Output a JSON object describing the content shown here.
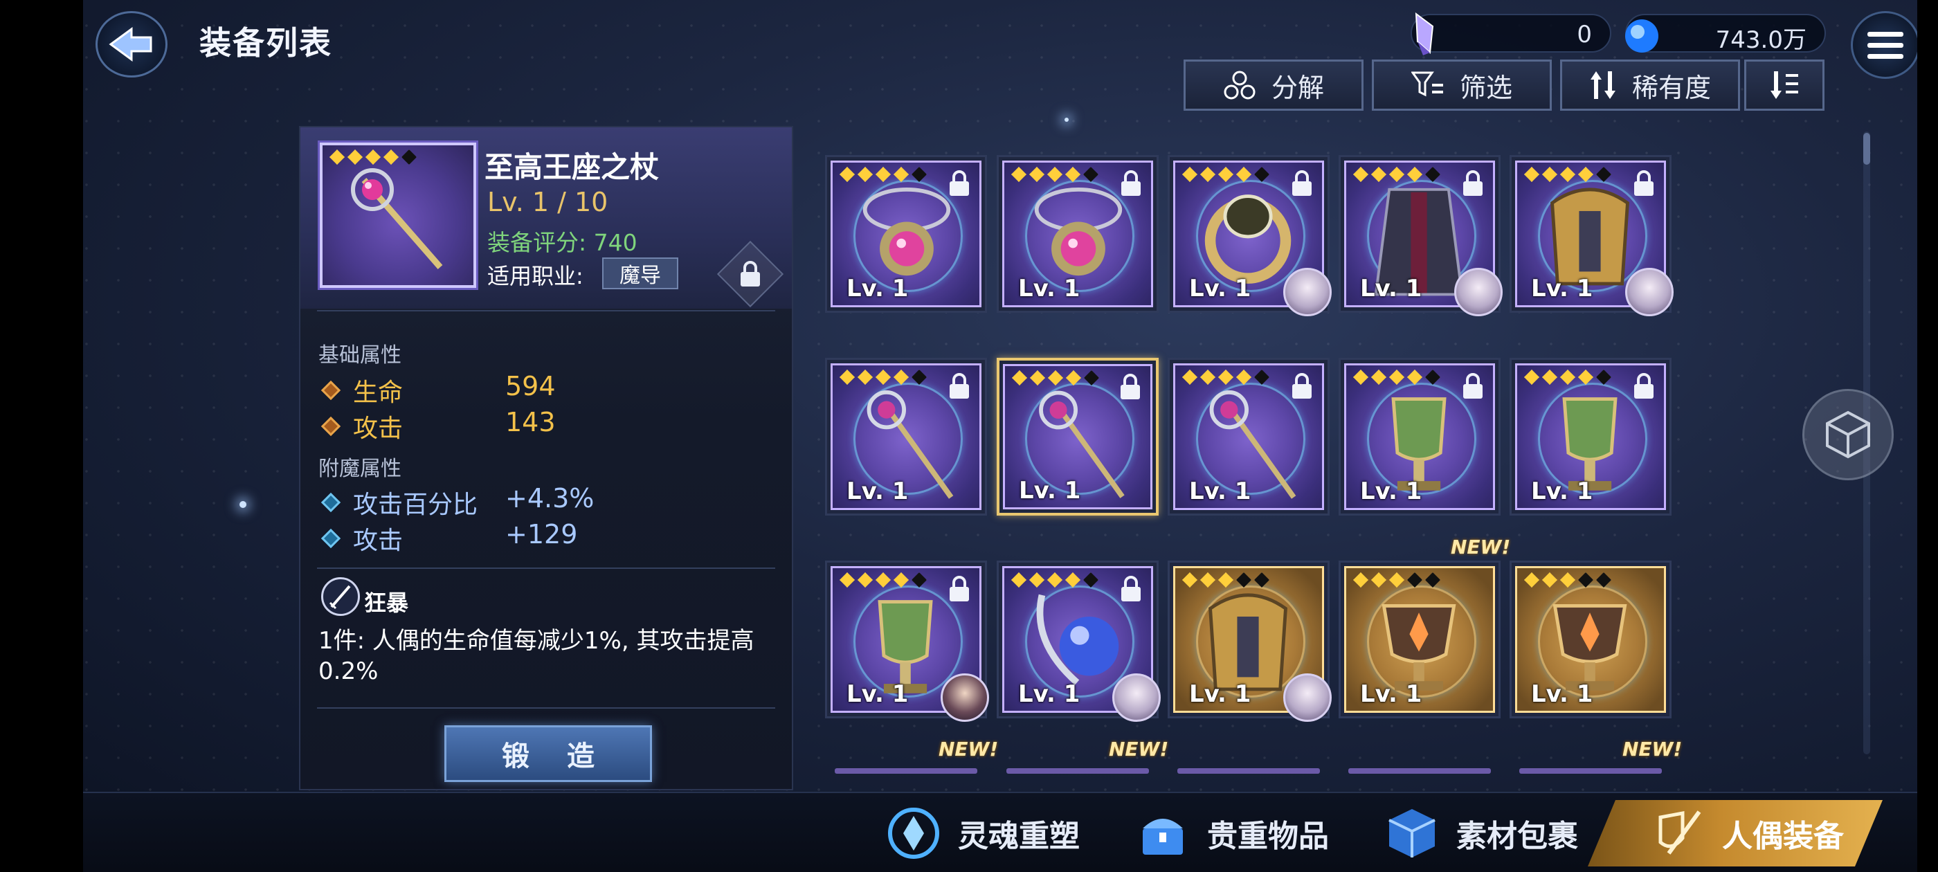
{
  "header": {
    "title": "装备列表",
    "currency_crystal": "0",
    "currency_orb": "743.0万"
  },
  "toolbar": {
    "decompose": "分解",
    "filter": "筛选",
    "rarity": "稀有度"
  },
  "detail": {
    "name": "至高王座之杖",
    "level": "Lv. 1 / 10",
    "score": "装备评分: 740",
    "class_label": "适用职业:",
    "class_value": "魔导",
    "base_header": "基础属性",
    "base": [
      {
        "label": "生命",
        "value": "594"
      },
      {
        "label": "攻击",
        "value": "143"
      }
    ],
    "enchant_header": "附魔属性",
    "enchant": [
      {
        "label": "攻击百分比",
        "value": "+4.3%"
      },
      {
        "label": "攻击",
        "value": "+129"
      }
    ],
    "set_name": "狂暴",
    "set_desc": "1件: 人偶的生命值每减少1%, 其攻击提高0.2%",
    "forge": "锻 造"
  },
  "items": [
    {
      "lv": "Lv. 1",
      "locked": true,
      "avatar": false,
      "selected": false,
      "gold": false,
      "stars": 4,
      "icon": "amulet-icon"
    },
    {
      "lv": "Lv. 1",
      "locked": true,
      "avatar": false,
      "selected": false,
      "gold": false,
      "stars": 4,
      "icon": "amulet-icon"
    },
    {
      "lv": "Lv. 1",
      "locked": true,
      "avatar": true,
      "selected": false,
      "gold": false,
      "stars": 4,
      "icon": "ring-icon"
    },
    {
      "lv": "Lv. 1",
      "locked": true,
      "avatar": true,
      "selected": false,
      "gold": false,
      "stars": 4,
      "icon": "coat-icon"
    },
    {
      "lv": "Lv. 1",
      "locked": true,
      "avatar": true,
      "selected": false,
      "gold": false,
      "stars": 4,
      "icon": "armor-icon"
    },
    {
      "lv": "Lv. 1",
      "locked": true,
      "avatar": false,
      "selected": false,
      "gold": false,
      "stars": 4,
      "icon": "staff-icon"
    },
    {
      "lv": "Lv. 1",
      "locked": true,
      "avatar": false,
      "selected": true,
      "gold": false,
      "stars": 4,
      "icon": "staff-icon"
    },
    {
      "lv": "Lv. 1",
      "locked": true,
      "avatar": false,
      "selected": false,
      "gold": false,
      "stars": 4,
      "icon": "staff-icon"
    },
    {
      "lv": "Lv. 1",
      "locked": true,
      "avatar": false,
      "selected": false,
      "gold": false,
      "stars": 4,
      "icon": "chalice-icon"
    },
    {
      "lv": "Lv. 1",
      "locked": true,
      "avatar": false,
      "selected": false,
      "gold": false,
      "stars": 4,
      "icon": "chalice-icon"
    },
    {
      "lv": "Lv. 1",
      "locked": true,
      "avatar": true,
      "selected": false,
      "gold": false,
      "stars": 4,
      "icon": "chalice-icon",
      "new": "NEW!"
    },
    {
      "lv": "Lv. 1",
      "locked": true,
      "avatar": true,
      "selected": false,
      "gold": false,
      "stars": 4,
      "icon": "orb-icon"
    },
    {
      "lv": "Lv. 1",
      "locked": false,
      "avatar": true,
      "selected": false,
      "gold": true,
      "stars": 3,
      "icon": "armor-icon"
    },
    {
      "lv": "Lv. 1",
      "locked": false,
      "avatar": false,
      "selected": false,
      "gold": true,
      "stars": 3,
      "icon": "goblet-icon"
    },
    {
      "lv": "Lv. 1",
      "locked": false,
      "avatar": false,
      "selected": false,
      "gold": true,
      "stars": 3,
      "icon": "goblet-icon"
    }
  ],
  "new_labels": [
    "NEW!",
    "NEW!",
    "NEW!",
    "NEW!"
  ],
  "bottom_tabs": [
    {
      "label": "灵魂重塑",
      "icon": "soul-icon"
    },
    {
      "label": "贵重物品",
      "icon": "chest-icon"
    },
    {
      "label": "素材包裹",
      "icon": "package-icon"
    },
    {
      "label": "人偶装备",
      "icon": "sword-shield-icon",
      "active": true
    }
  ]
}
